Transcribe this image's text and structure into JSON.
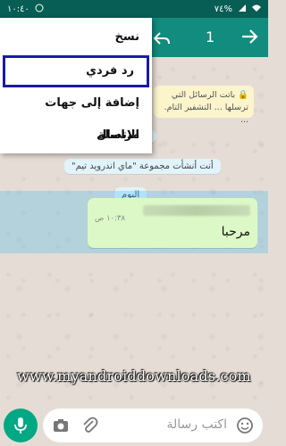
{
  "status_bar": {
    "time": "١٠:٤٠",
    "battery": "٧٤%"
  },
  "app_bar": {
    "selected_count": "1"
  },
  "menu": {
    "items": [
      {
        "label": "نسخ"
      },
      {
        "label": "رد فردي"
      },
      {
        "label": "إضافة إلى جهات الاتصال"
      },
      {
        "label": "مراسلة"
      }
    ]
  },
  "chat": {
    "encryption_notice": "🔒 باتت الرسائل التي ترسلها ... التشفير التام. ...",
    "group_created": "أنت أنشأت مجموعة \"ماي اندرويد تيم\"",
    "date_separator": "اليوم",
    "message": {
      "time": "١٠:٣٨ ص",
      "text": "مرحبا"
    }
  },
  "watermark": "www.myandroiddownloads.com",
  "composer": {
    "placeholder": "اكتب رسالة"
  }
}
